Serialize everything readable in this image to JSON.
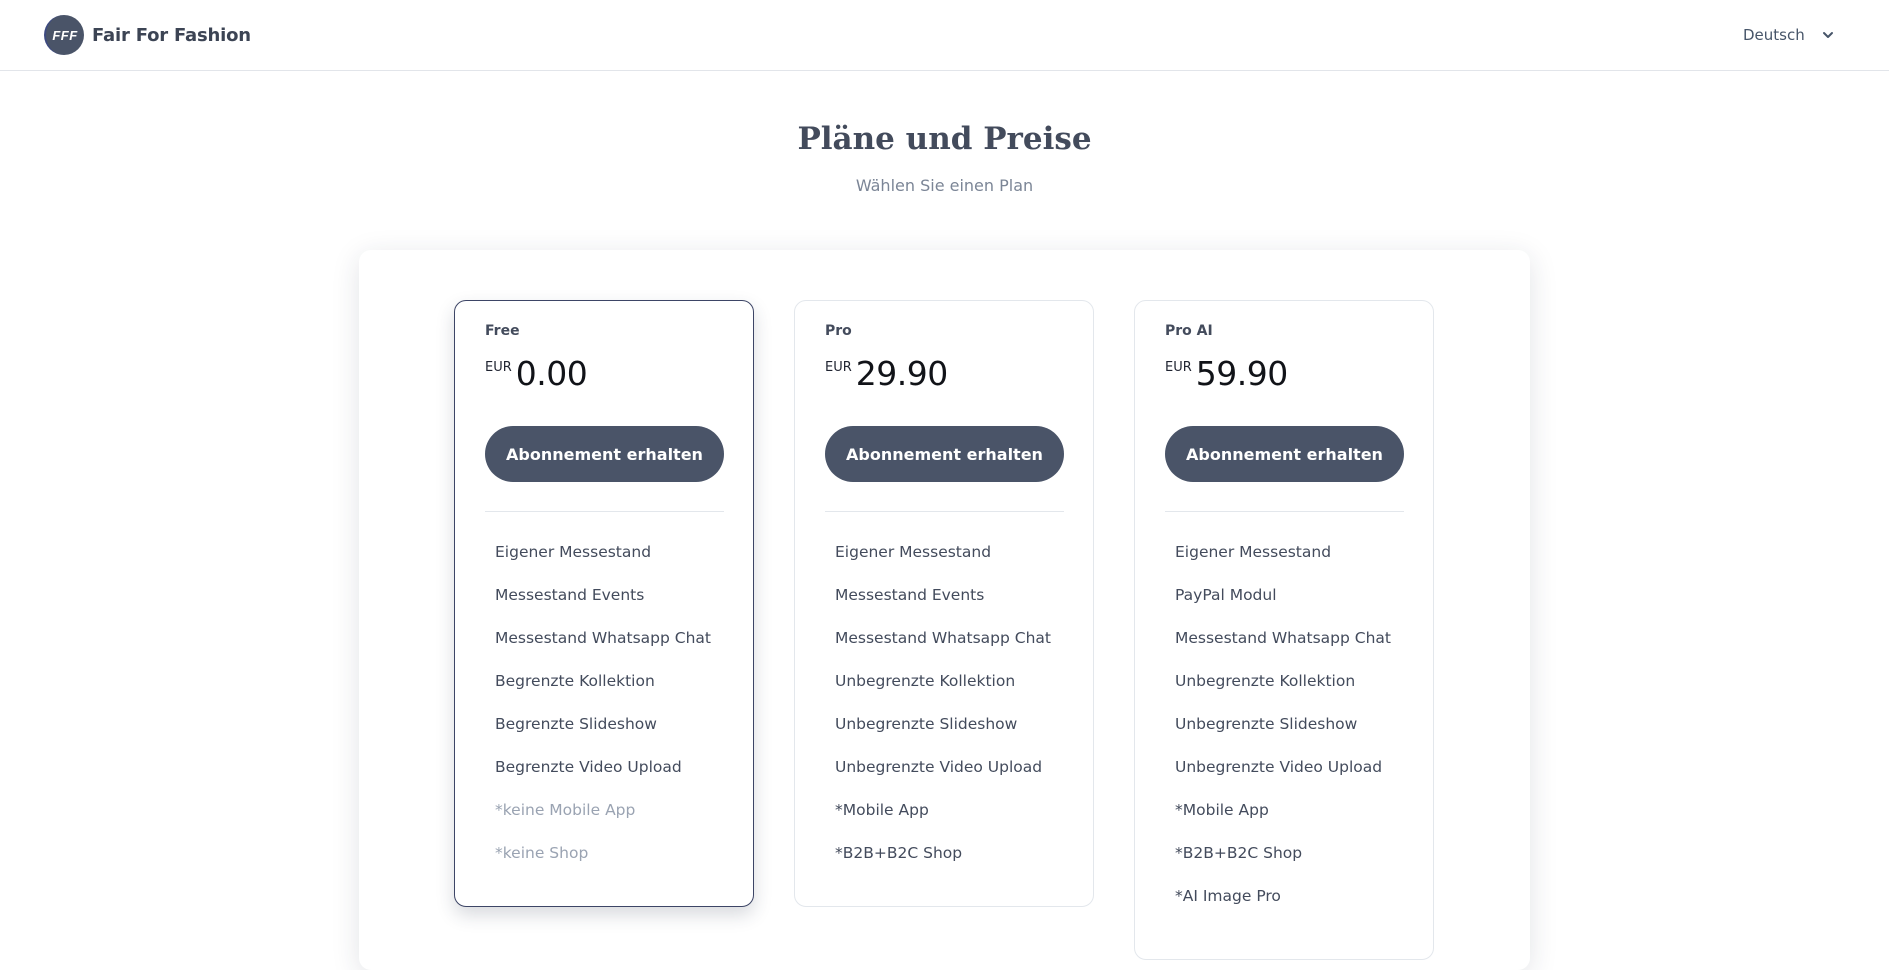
{
  "header": {
    "logo_badge": "FFF",
    "logo_text": "Fair For Fashion",
    "language": {
      "selected": "Deutsch",
      "icon": "chevron-down-icon"
    }
  },
  "page": {
    "title": "Pläne und Preise",
    "subtitle": "Wählen Sie einen Plan"
  },
  "plans": [
    {
      "name": "Free",
      "currency": "EUR",
      "price": "0.00",
      "button_label": "Abonnement erhalten",
      "selected": true,
      "features": [
        {
          "label": "Eigener Messestand",
          "muted": false
        },
        {
          "label": "Messestand Events",
          "muted": false
        },
        {
          "label": "Messestand Whatsapp Chat",
          "muted": false
        },
        {
          "label": "Begrenzte Kollektion",
          "muted": false
        },
        {
          "label": "Begrenzte Slideshow",
          "muted": false
        },
        {
          "label": "Begrenzte Video Upload",
          "muted": false
        },
        {
          "label": "*keine Mobile App",
          "muted": true
        },
        {
          "label": "*keine Shop",
          "muted": true
        }
      ]
    },
    {
      "name": "Pro",
      "currency": "EUR",
      "price": "29.90",
      "button_label": "Abonnement erhalten",
      "selected": false,
      "features": [
        {
          "label": "Eigener Messestand",
          "muted": false
        },
        {
          "label": "Messestand Events",
          "muted": false
        },
        {
          "label": "Messestand Whatsapp Chat",
          "muted": false
        },
        {
          "label": "Unbegrenzte Kollektion",
          "muted": false
        },
        {
          "label": "Unbegrenzte Slideshow",
          "muted": false
        },
        {
          "label": "Unbegrenzte Video Upload",
          "muted": false
        },
        {
          "label": "*Mobile App",
          "muted": false
        },
        {
          "label": "*B2B+B2C Shop",
          "muted": false
        }
      ]
    },
    {
      "name": "Pro AI",
      "currency": "EUR",
      "price": "59.90",
      "button_label": "Abonnement erhalten",
      "selected": false,
      "features": [
        {
          "label": "Eigener Messestand",
          "muted": false
        },
        {
          "label": "PayPal Modul",
          "muted": false
        },
        {
          "label": "Messestand Whatsapp Chat",
          "muted": false
        },
        {
          "label": "Unbegrenzte Kollektion",
          "muted": false
        },
        {
          "label": "Unbegrenzte Slideshow",
          "muted": false
        },
        {
          "label": "Unbegrenzte Video Upload",
          "muted": false
        },
        {
          "label": "*Mobile App",
          "muted": false
        },
        {
          "label": "*B2B+B2C Shop",
          "muted": false
        },
        {
          "label": "*AI Image Pro",
          "muted": false
        }
      ]
    }
  ],
  "colors": {
    "button_bg": "#4a5468",
    "selected_border": "#3d4566",
    "muted_text": "#9aa3b2"
  }
}
